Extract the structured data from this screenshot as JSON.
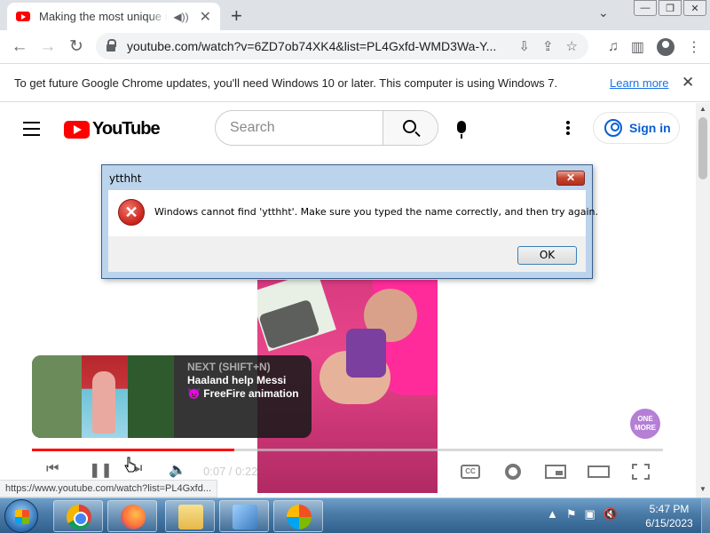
{
  "browser": {
    "tab_title": "Making the most unique ice",
    "url": "youtube.com/watch?v=6ZD7ob74XK4&list=PL4Gxfd-WMD3Wa-Y...",
    "infobar_message": "To get future Google Chrome updates, you'll need Windows 10 or later. This computer is using Windows 7.",
    "infobar_link": "Learn more"
  },
  "youtube": {
    "logo_text": "YouTube",
    "search_placeholder": "Search",
    "signin_label": "Sign in"
  },
  "player": {
    "progress_fraction": 0.32,
    "time": "0:07 / 0:22",
    "next_label": "NEXT (SHIFT+N)",
    "next_title_line1": "Haaland help Messi",
    "next_title_line2": "😈 FreeFire animation",
    "channel_badge": "ONE MORE"
  },
  "status_url": "https://www.youtube.com/watch?list=PL4Gxfd...",
  "dialog": {
    "title": "ytthht",
    "message": "Windows cannot find 'ytthht'. Make sure you typed the name correctly, and then try again.",
    "ok_label": "OK"
  },
  "taskbar": {
    "time": "5:47 PM",
    "date": "6/15/2023"
  }
}
